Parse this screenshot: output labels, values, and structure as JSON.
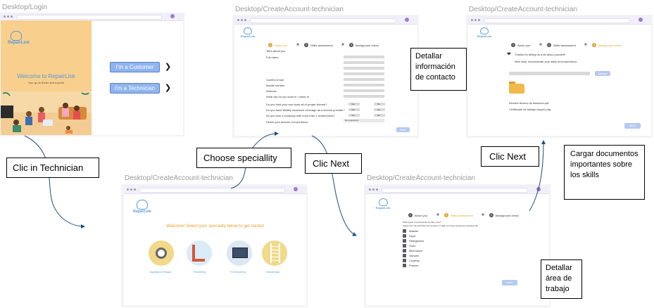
{
  "frames": {
    "login": {
      "label": "Desktop/Login",
      "logo": "RepairLink",
      "welcome": "Welcome to RepairLink",
      "tagline": "Your go-to finder and experts",
      "customer_button": "I'm a Customer",
      "technician_button": "I'm a Technician",
      "arrow_glyph": "❯"
    },
    "speciality": {
      "label": "Desktop/CreateAccount-technician",
      "logo": "RepairLink",
      "heading": "Welcome! Select your speciality below to get started",
      "options": [
        "Appliance Repair",
        "Plumbing",
        "TV Mounting",
        "Handyman"
      ]
    },
    "contact": {
      "label": "Desktop/CreateAccount-technician",
      "logo": "RepairLink",
      "steps": [
        "About you",
        "Skills assessment",
        "Background check"
      ],
      "fields": [
        "Tell's about you",
        "Full name",
        "Confirm email",
        "Mobile number",
        "Address",
        "What city do you work in / reach in"
      ],
      "questions": [
        "Do you hold your own tools all of proper license?",
        "Do you have liability insurance coverage as a service provider?",
        "Do you own a company with more than 1 worker/crew?",
        "Select your amount of experience"
      ],
      "yes": "Yes",
      "no": "No",
      "experience_value": "No experience",
      "next_button": "Next"
    },
    "skills": {
      "label": "Desktop/CreateAccount-technician",
      "logo": "RepairLink",
      "steps": [
        "About you",
        "Skills assessment",
        "Background check"
      ],
      "question": "What types of work would you like to do?",
      "subquestion": "Select from the list below the services or skills you have experience working with",
      "items": [
        "Washer",
        "Dryer",
        "Refrigerator",
        "Oven",
        "Microwave",
        "Vacuum",
        "Cooktop",
        "Freezer"
      ],
      "next_button": "Next"
    },
    "documents": {
      "label": "Desktop/CreateAccount-technician",
      "logo": "RepairLink",
      "steps": [
        "About you",
        "Skills assessment",
        "Background check"
      ],
      "thanks": "Thanks for telling us a bit about yourself!",
      "next_step": "Next step, demonstrate your skills and experience.",
      "upload_button": "Upload",
      "files": [
        "Informe tecnico de titulación.pdf",
        "Certificado de trabajo seguro.png"
      ],
      "next_button": "Next"
    }
  },
  "callouts": {
    "clic_technician": "Clic in Technician",
    "choose_speciality": "Choose speciallity",
    "clic_next_1": "Clic Next",
    "clic_next_2": "Clic Next",
    "detallar_contacto": "Detallar información de contacto",
    "cargar_documentos": "Cargar documentos importantes sobre los skills",
    "detallar_area": "Detallar área de trabajo"
  },
  "colors": {
    "accent": "#5b9bd5",
    "button": "#8fb4ef",
    "login_panel": "#f8cf8d",
    "step_active": "#e5a132",
    "arrow": "#1f4e79"
  }
}
